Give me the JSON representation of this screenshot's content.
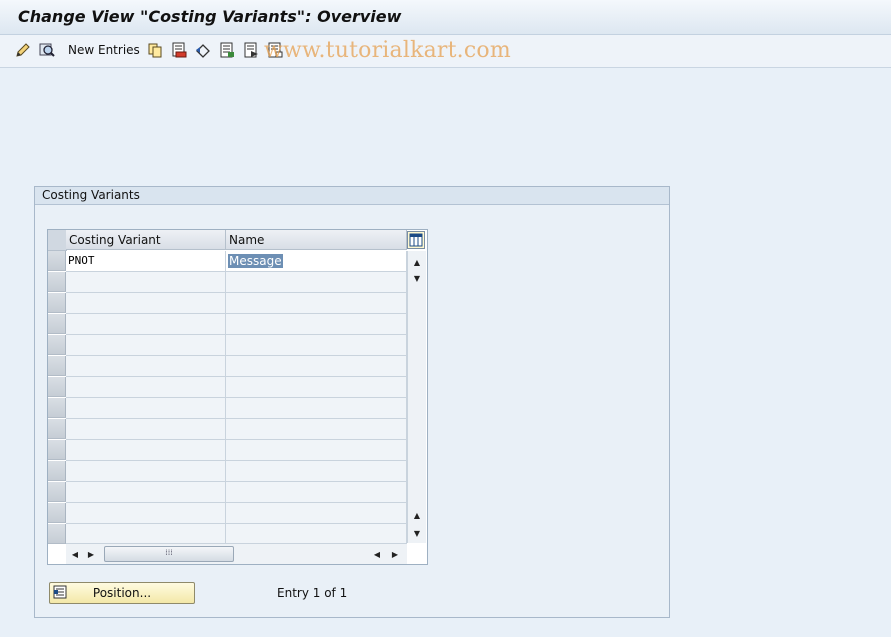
{
  "window": {
    "title": "Change View \"Costing Variants\": Overview"
  },
  "toolbar": {
    "new_entries_label": "New Entries",
    "icons": [
      "display-change-icon",
      "details-icon",
      "copy-icon",
      "delete-icon",
      "undo-change-icon",
      "select-all-icon",
      "select-block-icon",
      "deselect-all-icon"
    ],
    "watermark": "www.tutorialkart.com"
  },
  "panel": {
    "title": "Costing Variants",
    "columns": [
      "Costing Variant",
      "Name"
    ],
    "rows": [
      {
        "variant": "PNOT",
        "name": "Message"
      }
    ],
    "empty_rows": 13,
    "position_button_label": "Position...",
    "entry_info": "Entry 1 of 1"
  },
  "colors": {
    "background": "#e8f0f8",
    "selected_text_bg": "#6d8fb4",
    "button_bg": "#f3e8a8"
  }
}
